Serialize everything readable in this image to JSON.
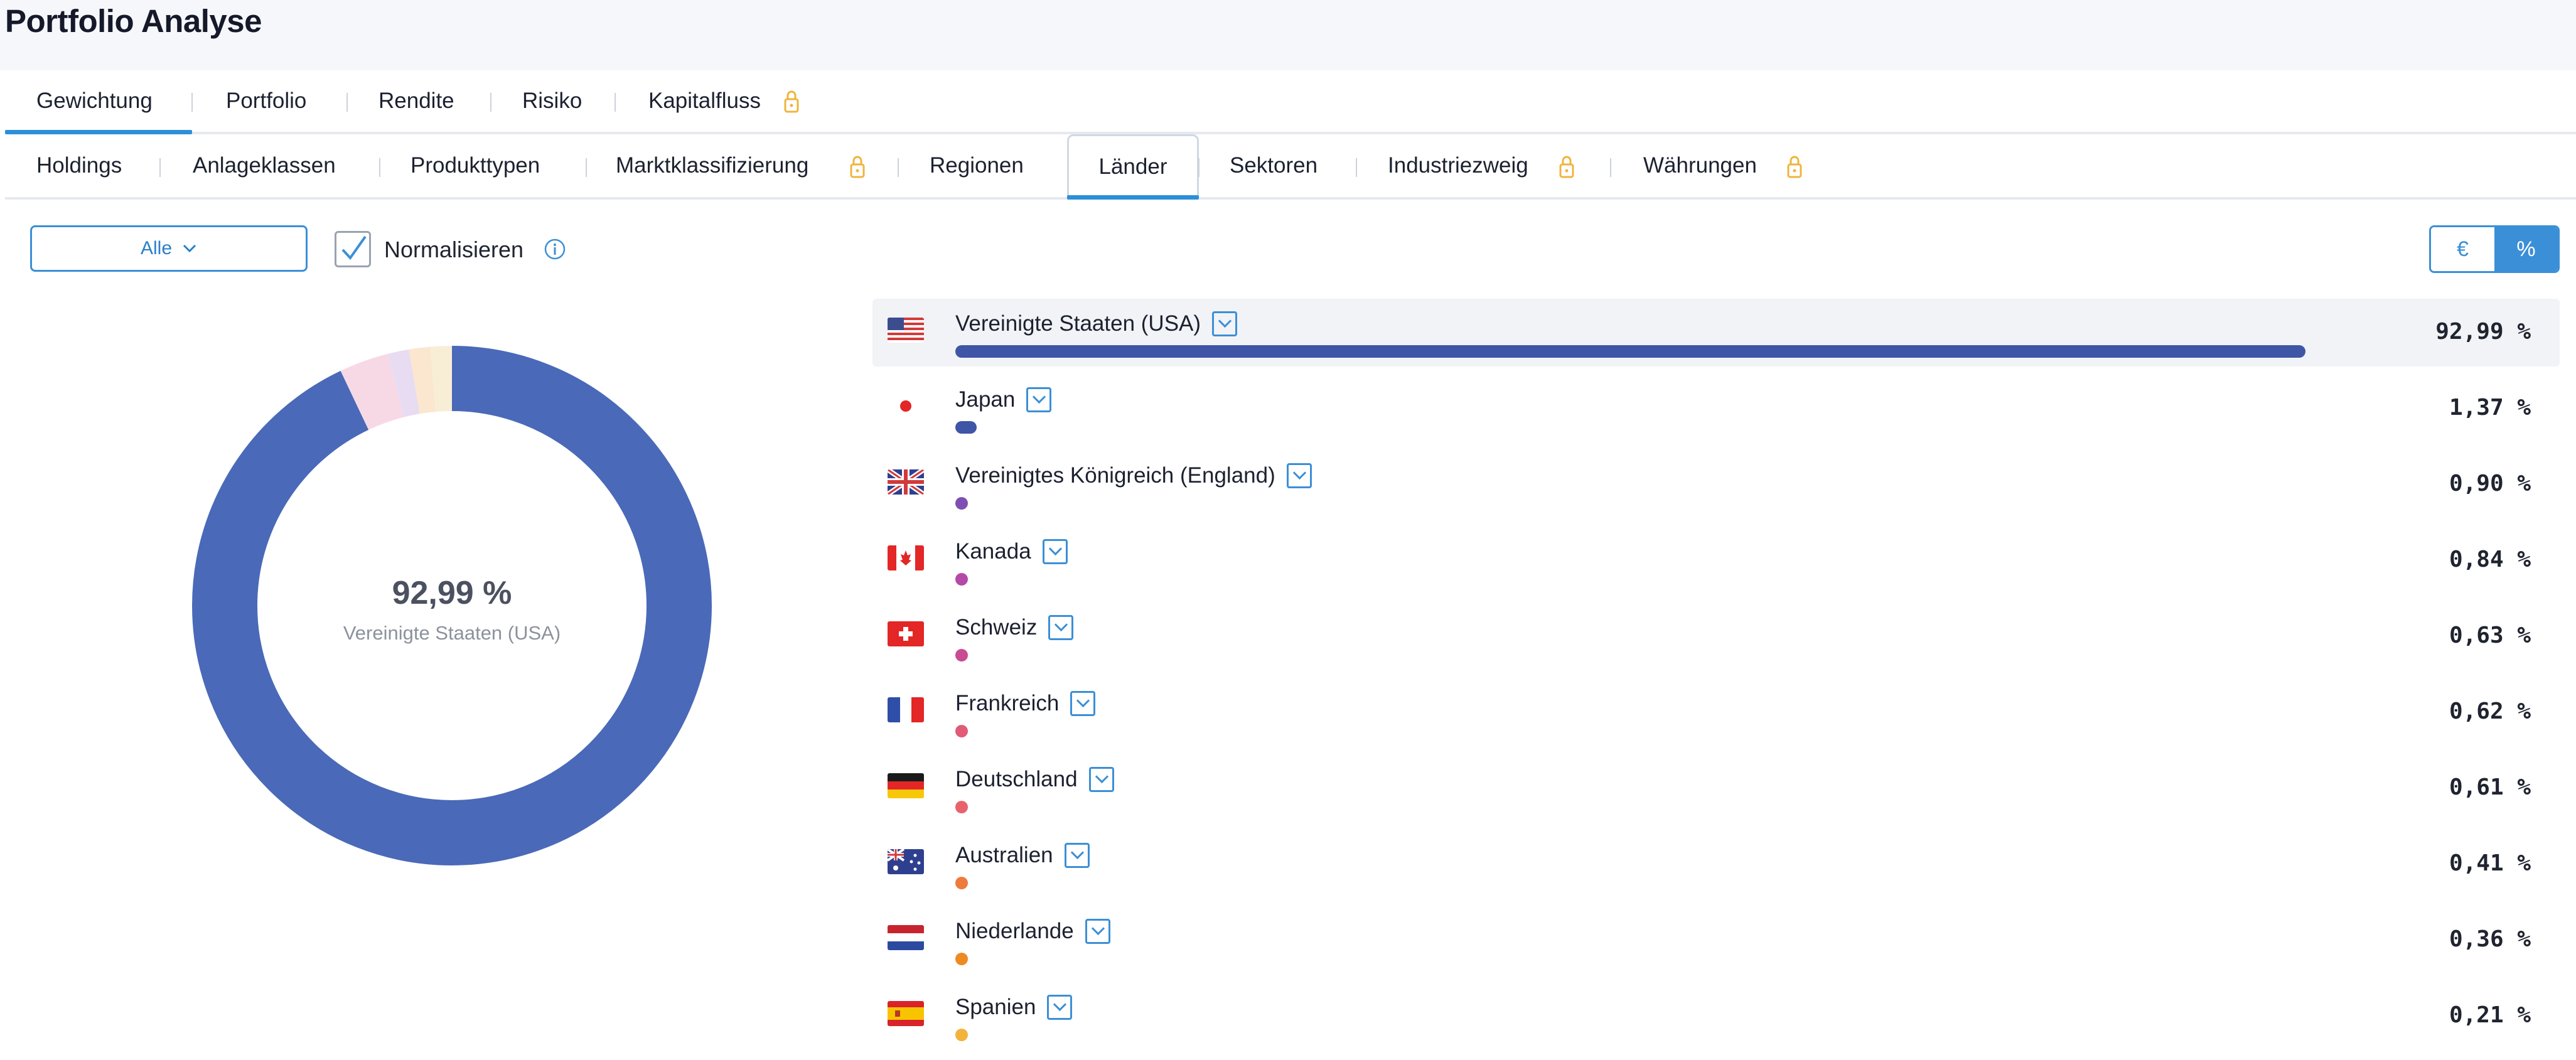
{
  "page": {
    "title": "Portfolio Analyse"
  },
  "main_tabs": [
    {
      "label": "Gewichtung",
      "active": true
    },
    {
      "label": "Portfolio"
    },
    {
      "label": "Rendite"
    },
    {
      "label": "Risiko"
    },
    {
      "label": "Kapitalfluss",
      "locked": true
    }
  ],
  "sub_tabs": [
    {
      "label": "Holdings"
    },
    {
      "label": "Anlageklassen"
    },
    {
      "label": "Produkttypen"
    },
    {
      "label": "Marktklassifizierung",
      "locked": true
    },
    {
      "label": "Regionen"
    },
    {
      "label": "Länder",
      "active": true
    },
    {
      "label": "Sektoren"
    },
    {
      "label": "Industriezweig",
      "locked": true
    },
    {
      "label": "Währungen",
      "locked": true
    }
  ],
  "filter": {
    "selected": "Alle"
  },
  "normalize": {
    "label": "Normalisieren",
    "checked": true
  },
  "unit_toggle": {
    "euro": "€",
    "percent": "%",
    "active": "percent"
  },
  "donut": {
    "value": "92,99 %",
    "label": "Vereinigte Staaten (USA)"
  },
  "colors": {
    "accent": "#3b8fd6",
    "usa": "#3f5aa8",
    "lock": "#f0b43c"
  },
  "countries": [
    {
      "name": "Vereinigte Staaten (USA)",
      "percent_label": "92,99 %",
      "value": 92.99,
      "flag": "us-flag",
      "color": "#3f55a5",
      "highlight": true
    },
    {
      "name": "Japan",
      "percent_label": "1,37 %",
      "value": 1.37,
      "flag": "jp-flag",
      "color": "#3f55a5"
    },
    {
      "name": "Vereinigtes Königreich (England)",
      "percent_label": "0,90 %",
      "value": 0.9,
      "flag": "gb-flag",
      "color": "#7e4fb3"
    },
    {
      "name": "Kanada",
      "percent_label": "0,84 %",
      "value": 0.84,
      "flag": "ca-flag",
      "color": "#b44aa7"
    },
    {
      "name": "Schweiz",
      "percent_label": "0,63 %",
      "value": 0.63,
      "flag": "ch-flag",
      "color": "#c94b93"
    },
    {
      "name": "Frankreich",
      "percent_label": "0,62 %",
      "value": 0.62,
      "flag": "fr-flag",
      "color": "#e15a78"
    },
    {
      "name": "Deutschland",
      "percent_label": "0,61 %",
      "value": 0.61,
      "flag": "de-flag",
      "color": "#e8626c"
    },
    {
      "name": "Australien",
      "percent_label": "0,41 %",
      "value": 0.41,
      "flag": "au-flag",
      "color": "#ee7a3c"
    },
    {
      "name": "Niederlande",
      "percent_label": "0,36 %",
      "value": 0.36,
      "flag": "nl-flag",
      "color": "#ee8a22"
    },
    {
      "name": "Spanien",
      "percent_label": "0,21 %",
      "value": 0.21,
      "flag": "es-flag",
      "color": "#f2b33d"
    }
  ]
}
